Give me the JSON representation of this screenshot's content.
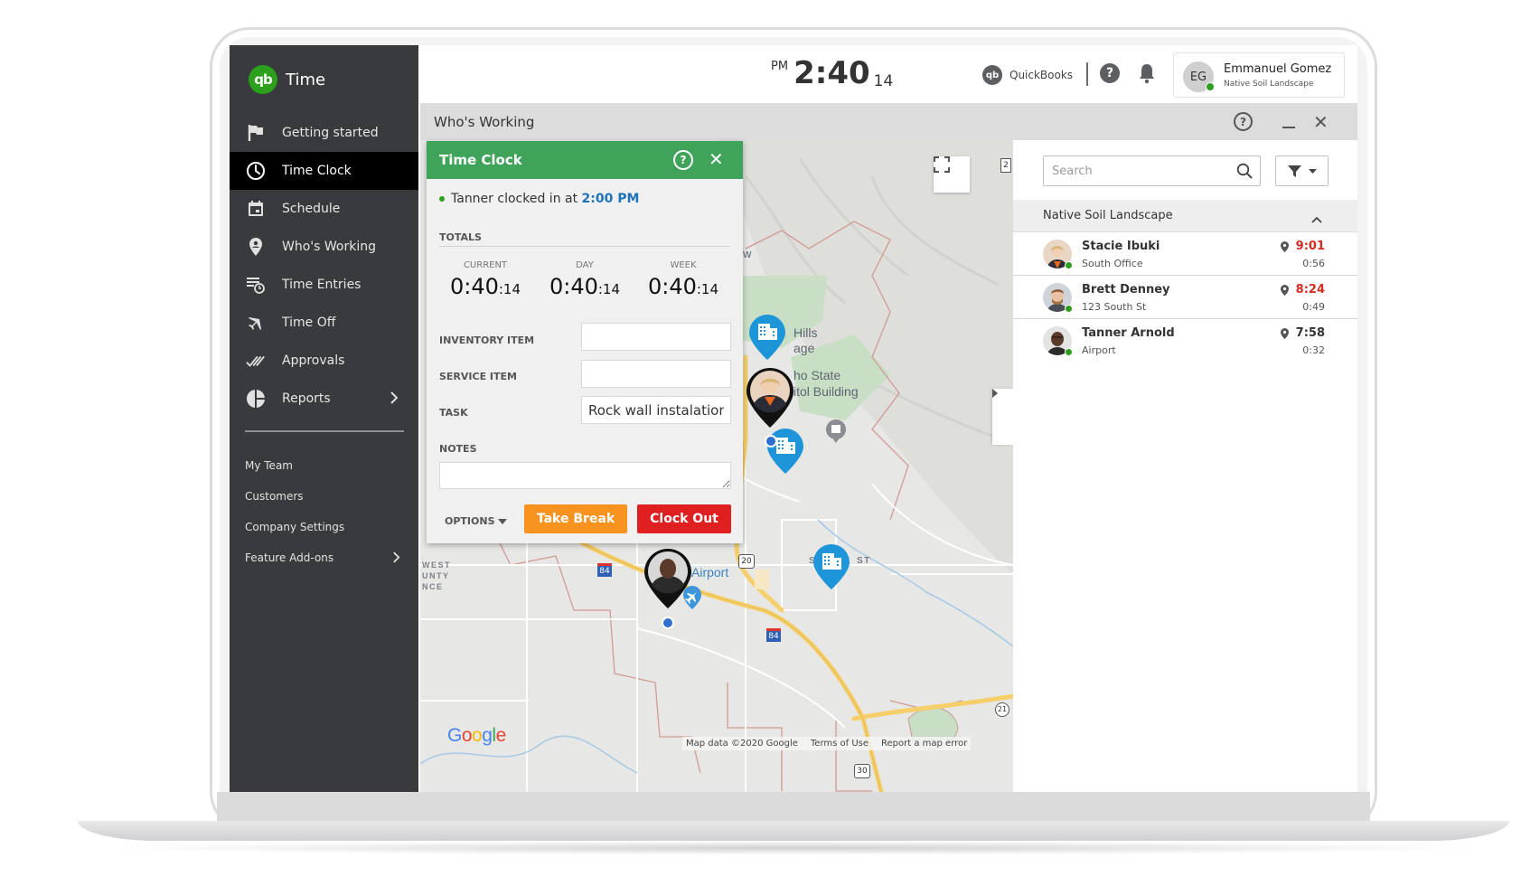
{
  "app": {
    "name": "Time",
    "logo_text": "qb"
  },
  "sidebar": {
    "items": [
      {
        "label": "Getting started",
        "icon": "flag-icon",
        "active": false
      },
      {
        "label": "Time Clock",
        "icon": "clock-icon",
        "active": true
      },
      {
        "label": "Schedule",
        "icon": "calendar-icon",
        "active": false
      },
      {
        "label": "Who's Working",
        "icon": "map-pin-person-icon",
        "active": false
      },
      {
        "label": "Time Entries",
        "icon": "list-clock-icon",
        "active": false
      },
      {
        "label": "Time Off",
        "icon": "airplane-icon",
        "active": false
      },
      {
        "label": "Approvals",
        "icon": "double-check-icon",
        "active": false
      },
      {
        "label": "Reports",
        "icon": "pie-chart-icon",
        "active": false,
        "has_submenu": true
      }
    ],
    "secondary": [
      {
        "label": "My Team"
      },
      {
        "label": "Customers"
      },
      {
        "label": "Company Settings"
      },
      {
        "label": "Feature Add-ons",
        "has_submenu": true
      }
    ]
  },
  "topbar": {
    "clock": {
      "ampm": "PM",
      "time": "2:40",
      "seconds": "14"
    },
    "quickbooks_label": "QuickBooks",
    "quickbooks_logo": "qb",
    "help_label": "?",
    "user": {
      "initials": "EG",
      "name": "Emmanuel Gomez",
      "company": "Native Soil Landscape",
      "online": true
    }
  },
  "window": {
    "title": "Who's Working",
    "help_label": "?",
    "close_label": "✕"
  },
  "time_clock": {
    "title": "Time Clock",
    "help_label": "?",
    "close_label": "✕",
    "status_name": "Tanner",
    "status_text": "clocked in at",
    "status_time": "2:00 PM",
    "totals_label": "TOTALS",
    "totals": [
      {
        "label": "CURRENT",
        "value": "0:40",
        "seconds": ":14"
      },
      {
        "label": "DAY",
        "value": "0:40",
        "seconds": ":14"
      },
      {
        "label": "WEEK",
        "value": "0:40",
        "seconds": ":14"
      }
    ],
    "fields": {
      "inventory_label": "INVENTORY ITEM",
      "inventory_value": "",
      "service_label": "SERVICE ITEM",
      "service_value": "",
      "task_label": "TASK",
      "task_value": "Rock wall instalation",
      "notes_label": "NOTES",
      "notes_value": ""
    },
    "options_label": "OPTIONS",
    "take_break_label": "Take Break",
    "clock_out_label": "Clock Out"
  },
  "map": {
    "labels": {
      "hills": "Hills",
      "age": "age",
      "state": "ho State",
      "capitol": "itol Building",
      "airport": "Airport",
      "west1": "WEST",
      "west2": "UNTY",
      "west3": "NCE",
      "so": "SO",
      "st": "ST",
      "w": "w"
    },
    "shields": {
      "i84_a": "84",
      "i84_b": "84",
      "us20": "20",
      "us30": "30",
      "r21": "21",
      "r2": "2"
    },
    "google_letters": [
      "G",
      "o",
      "o",
      "g",
      "l",
      "e"
    ],
    "footer": {
      "data": "Map data ©2020 Google",
      "terms": "Terms of Use",
      "report": "Report a map error"
    }
  },
  "right_panel": {
    "search_placeholder": "Search",
    "group_name": "Native Soil Landscape",
    "employees": [
      {
        "name": "Stacie Ibuki",
        "location": "South Office",
        "time": "9:01",
        "duration": "0:56",
        "late": true
      },
      {
        "name": "Brett Denney",
        "location": "123 South St",
        "time": "8:24",
        "duration": "0:49",
        "late": true
      },
      {
        "name": "Tanner Arnold",
        "location": "Airport",
        "time": "7:58",
        "duration": "0:32",
        "late": false
      }
    ]
  },
  "colors": {
    "brand_green": "#2ca01c",
    "timeclock_green": "#3fa35a",
    "take_break_orange": "#f7931e",
    "clock_out_red": "#e02020",
    "late_red": "#d52b1e",
    "pin_blue": "#1e95d9",
    "link_blue": "#1f73b7",
    "sidebar_bg": "#393a3d"
  }
}
